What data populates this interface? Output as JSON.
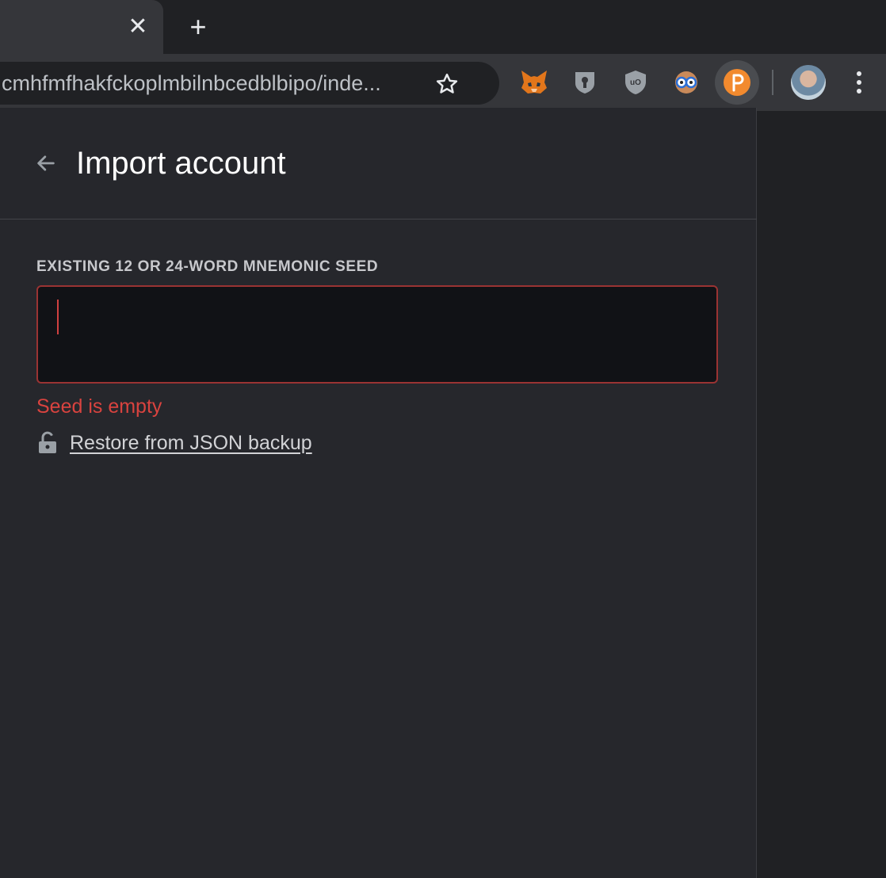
{
  "browser": {
    "tab_close_glyph": "✕",
    "new_tab_glyph": "+",
    "url": "cmhfmfhakfckoplmbilnbcedblbipo/inde...",
    "extensions": [
      "metamask-fox-icon",
      "bitwarden-shield-icon",
      "ublock-origin-icon",
      "owl-glasses-icon",
      "polkadot-p-icon"
    ]
  },
  "popup": {
    "title": "Import account",
    "seed_label": "EXISTING 12 OR 24-WORD MNEMONIC SEED",
    "seed_value": "",
    "error": "Seed is empty",
    "restore_link": "Restore from JSON backup"
  },
  "colors": {
    "error": "#d9433f",
    "input_border": "#9a3333",
    "polkadot_orange": "#f28a2e"
  }
}
